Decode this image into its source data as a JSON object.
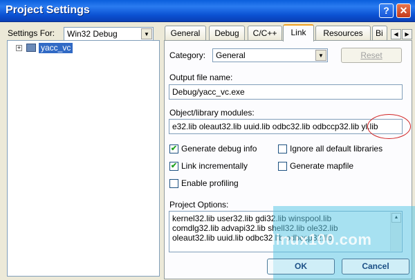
{
  "window": {
    "title": "Project Settings",
    "help_glyph": "?",
    "close_glyph": "✕"
  },
  "left_pane": {
    "settings_for_label": "Settings For:",
    "settings_for_value": "Win32 Debug",
    "tree": [
      {
        "label": "yacc_vc",
        "expander": "+",
        "selected": true
      }
    ]
  },
  "tabs": [
    {
      "label": "General",
      "active": false
    },
    {
      "label": "Debug",
      "active": false
    },
    {
      "label": "C/C++",
      "active": false
    },
    {
      "label": "Link",
      "active": true
    },
    {
      "label": "Resources",
      "active": false
    },
    {
      "label": "Bi",
      "active": false
    }
  ],
  "link_tab": {
    "category_label": "Category:",
    "category_value": "General",
    "reset_label": "Reset",
    "output_label": "Output file name:",
    "output_value": "Debug/yacc_vc.exe",
    "modules_label": "Object/library modules:",
    "modules_value": "e32.lib oleaut32.lib uuid.lib odbc32.lib odbccp32.lib yl.lib",
    "checks": [
      {
        "label": "Generate debug info",
        "checked": true
      },
      {
        "label": "Ignore all default libraries",
        "checked": false
      },
      {
        "label": "Link incrementally",
        "checked": true
      },
      {
        "label": "Generate mapfile",
        "checked": false
      },
      {
        "label": "Enable profiling",
        "checked": false
      }
    ],
    "project_options_label": "Project Options:",
    "project_options_lines": [
      "kernel32.lib user32.lib gdi32.lib winspool.lib",
      "comdlg32.lib advapi32.lib shell32.lib ole32.lib",
      "oleaut32.lib uuid.lib odbc32.lib odbccp32.lib"
    ]
  },
  "buttons": {
    "ok": "OK",
    "cancel": "Cancel"
  },
  "watermark": "linux100.com",
  "colors": {
    "titlebar": "#0a5fdc",
    "selection": "#316ac5",
    "annotation_circle": "#d02020",
    "overlay": "#5fc8e6"
  }
}
